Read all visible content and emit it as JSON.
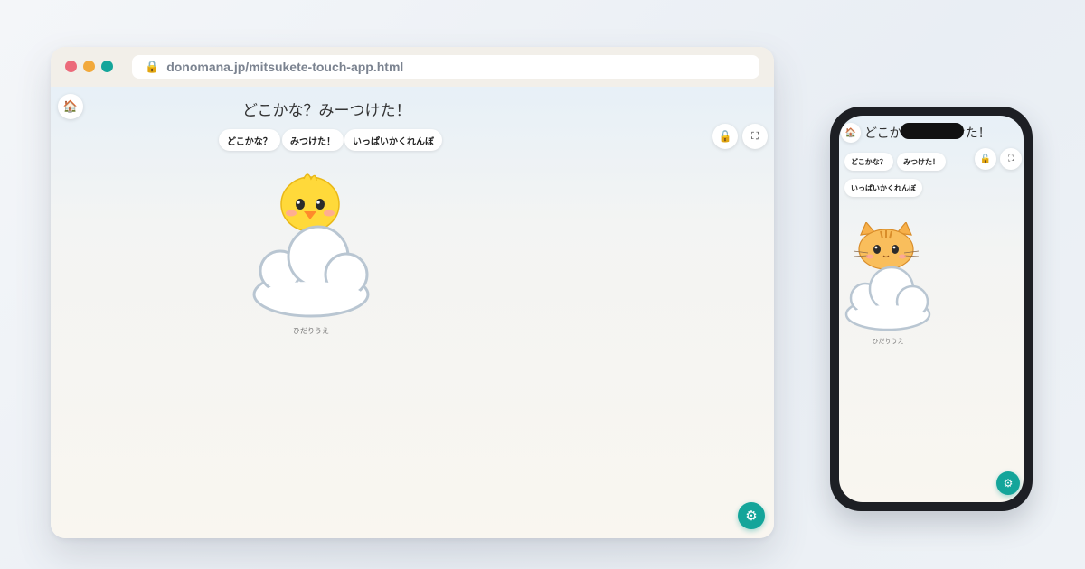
{
  "browser": {
    "url": "donomana.jp/mitsukete-touch-app.html"
  },
  "app": {
    "title": "どこかな？みーつけた！",
    "home_icon": "🏠",
    "lock_icon": "🔓",
    "fullscreen_icon": "⛶",
    "settings_icon": "⚙",
    "modes": [
      "どこかな？",
      "みつけた！",
      "いっぱいかくれんぼ"
    ],
    "desktop_caption": "ひだりうえ",
    "desktop_character": "chick",
    "accent_color": "#14a59a"
  },
  "phone": {
    "title": "どこかなみーつけた！",
    "modes": [
      "どこかな？",
      "みつけた！",
      "いっぱいかくれんぼ"
    ],
    "caption": "ひだりうえ",
    "character": "cat"
  }
}
